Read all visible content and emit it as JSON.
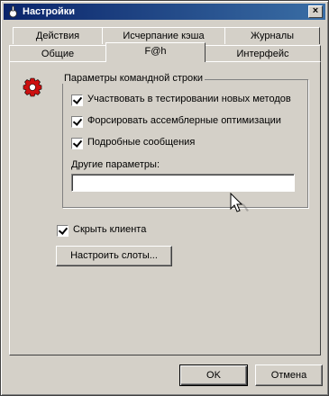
{
  "window": {
    "title": "Настройки",
    "close_glyph": "×"
  },
  "tabs": {
    "row_top": [
      "Действия",
      "Исчерпание кэша",
      "Журналы"
    ],
    "row_bottom": [
      "Общие",
      "F@h",
      "Интерфейс"
    ],
    "active": "F@h"
  },
  "group": {
    "title": "Параметры командной строки",
    "checkboxes": [
      {
        "label": "Участвовать в тестировании новых методов",
        "checked": true
      },
      {
        "label": "Форсировать ассемблерные оптимизации",
        "checked": true
      },
      {
        "label": "Подробные сообщения",
        "checked": true
      }
    ],
    "other_params_label": "Другие параметры:",
    "other_params_value": ""
  },
  "hide_client": {
    "label": "Скрыть клиента",
    "checked": true
  },
  "configure_slots_label": "Настроить слоты...",
  "dialog_buttons": {
    "ok": "OK",
    "cancel": "Отмена"
  },
  "icons": {
    "app": "app-icon",
    "settings": "red-gear-icon",
    "cursor": "mouse-cursor-icon"
  },
  "colors": {
    "title_start": "#0a246a",
    "title_end": "#3a6ea5",
    "face": "#d4d0c8",
    "gear": "#cc1010"
  }
}
